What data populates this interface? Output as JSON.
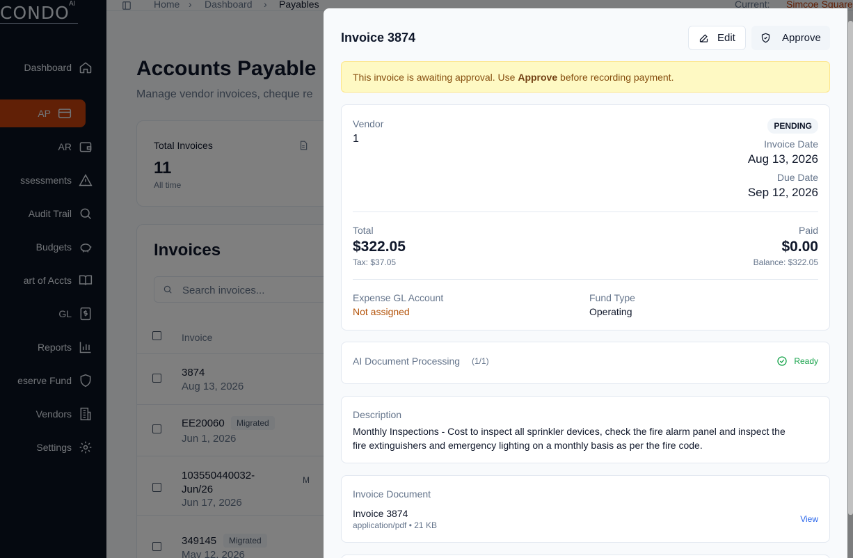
{
  "sidebar": {
    "logo": "CONDO",
    "logo_sup": "AI",
    "items": [
      {
        "label": "Dashboard",
        "icon": "home-icon"
      },
      {
        "label": "AP",
        "icon": "credit-card-icon",
        "active": true
      },
      {
        "label": "AR",
        "icon": "wallet-icon"
      },
      {
        "label": "ssessments",
        "icon": "warning-icon"
      },
      {
        "label": "Audit Trail",
        "icon": "search-icon"
      },
      {
        "label": "Budgets",
        "icon": "piggy-bank-icon"
      },
      {
        "label": "art of Accts",
        "icon": "book-icon"
      },
      {
        "label": "GL",
        "icon": "dollar-doc-icon"
      },
      {
        "label": "Reports",
        "icon": "bar-chart-icon"
      },
      {
        "label": "eserve Fund",
        "icon": "shield-icon"
      },
      {
        "label": "Vendors",
        "icon": "building-icon"
      },
      {
        "label": "Settings",
        "icon": "gear-icon"
      }
    ]
  },
  "breadcrumb": [
    "Home",
    "Dashboard",
    "Payables"
  ],
  "current": {
    "label": "Current:",
    "value": "Simcoe Square"
  },
  "page": {
    "title": "Accounts Payable",
    "subtitle": "Manage vendor invoices, cheque re"
  },
  "stats": {
    "label": "Total Invoices",
    "value": "11",
    "sub": "All time"
  },
  "invoices": {
    "title": "Invoices",
    "search_placeholder": "Search invoices...",
    "col_invoice": "Invoice",
    "rows": [
      {
        "id": "3874",
        "date": "Aug 13, 2026",
        "badge": ""
      },
      {
        "id": "EE20060",
        "date": "Jun 1, 2026",
        "badge": "Migrated"
      },
      {
        "id": "103550440032-\nJun/26",
        "date": "Jun 17, 2026",
        "badge": "M"
      },
      {
        "id": "349145",
        "date": "May 12, 2026",
        "badge": "Migrated"
      }
    ]
  },
  "panel": {
    "title": "Invoice 3874",
    "edit_label": "Edit",
    "approve_label": "Approve",
    "alert": {
      "pre": "This invoice is awaiting approval. Use ",
      "bold": "Approve",
      "post": " before recording payment."
    },
    "vendor_label": "Vendor",
    "vendor_value": "1",
    "status": "PENDING",
    "invoice_date_label": "Invoice Date",
    "invoice_date": "Aug 13, 2026",
    "due_date_label": "Due Date",
    "due_date": "Sep 12, 2026",
    "total_label": "Total",
    "total": "$322.05",
    "tax": "Tax: $37.05",
    "paid_label": "Paid",
    "paid": "$0.00",
    "balance": "Balance: $322.05",
    "gl_label": "Expense GL Account",
    "gl_value": "Not assigned",
    "fund_label": "Fund Type",
    "fund_value": "Operating",
    "ai_label": "AI Document Processing",
    "ai_count": "(1/1)",
    "ai_status": "Ready",
    "desc_label": "Description",
    "desc_line1": "Monthly Inspections - Cost to inspect all sprinkler devices, check the fire alarm panel and inspect the",
    "desc_line2": "fire extinguishers and emergency lighting on a monthly basis as per the fire code.",
    "doc_label": "Invoice Document",
    "doc_name": "Invoice 3874",
    "doc_meta": "application/pdf • 21 KB",
    "doc_view": "View"
  },
  "colors": {
    "accent": "#c2410c",
    "warn_bg": "#fef9c3",
    "warn_text": "#854d0e",
    "gl_text": "#b45309",
    "ready": "#16a34a",
    "link": "#2563eb"
  }
}
